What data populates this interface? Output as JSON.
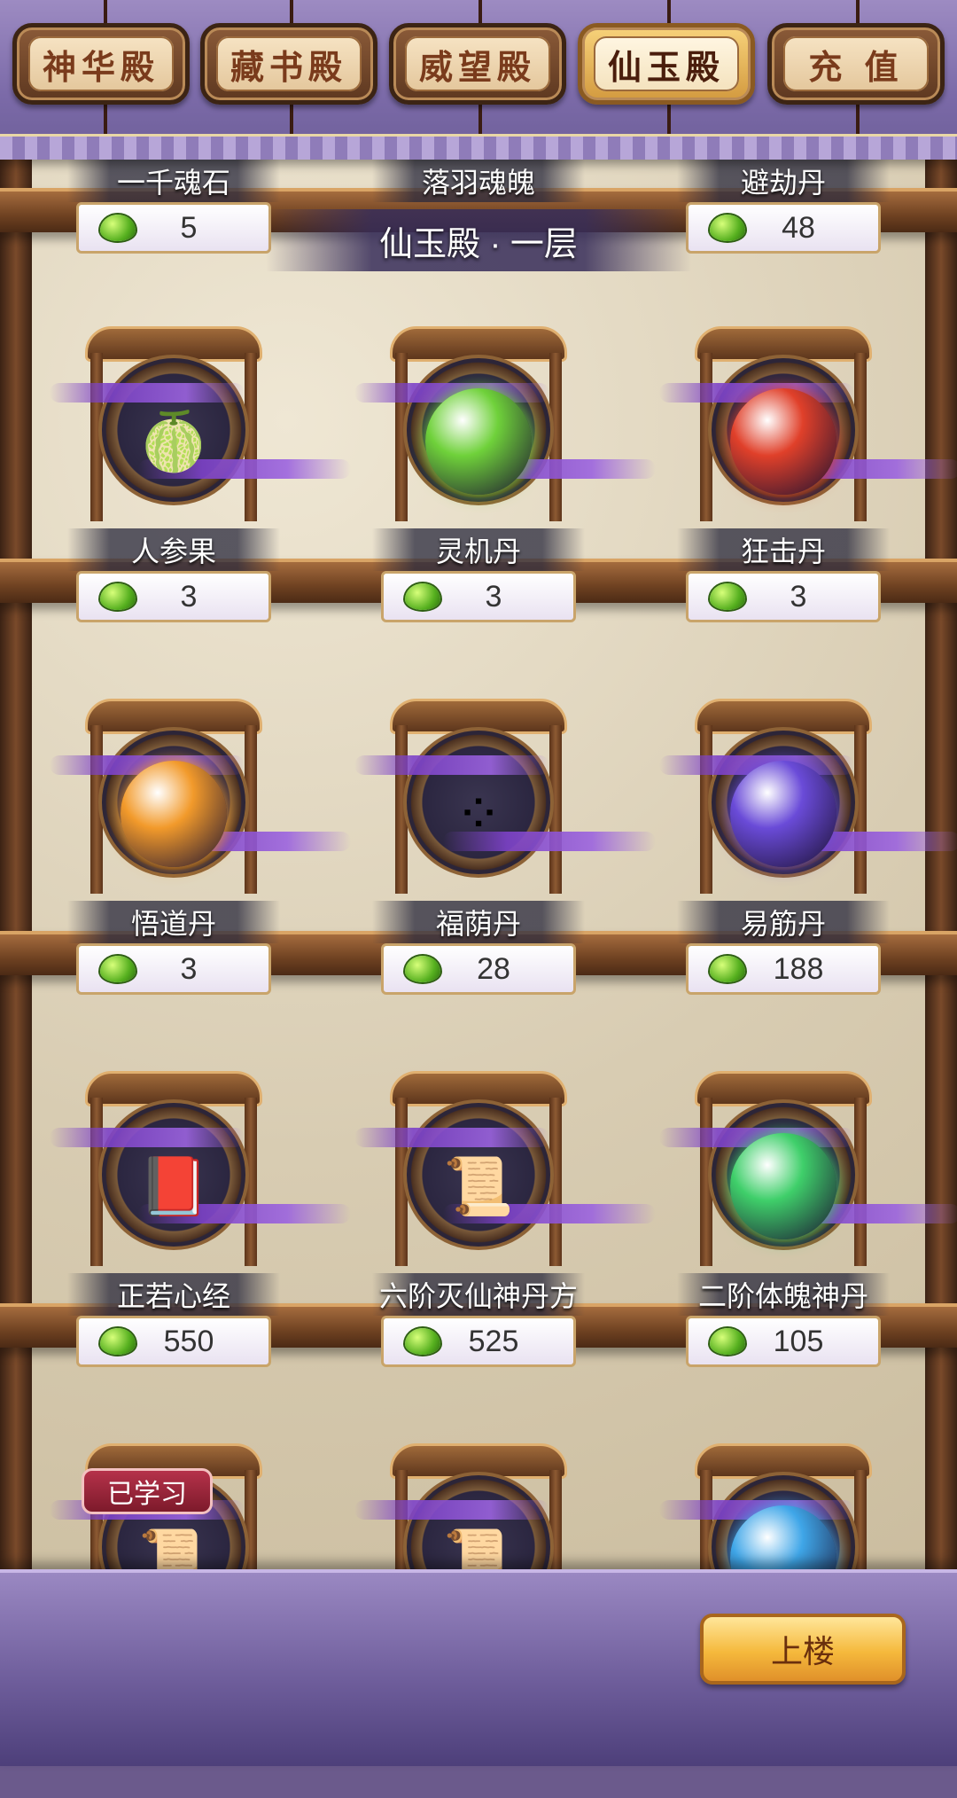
{
  "tabs": [
    {
      "label": "神华殿",
      "active": false
    },
    {
      "label": "藏书殿",
      "active": false
    },
    {
      "label": "威望殿",
      "active": false
    },
    {
      "label": "仙玉殿",
      "active": true
    },
    {
      "label": "充 值",
      "active": false
    }
  ],
  "floor_label": "仙玉殿 · 一层",
  "currency_icon": "jade-coin-icon",
  "top_row": [
    {
      "name": "一千魂石",
      "price": "5"
    },
    {
      "name": "落羽魂魄",
      "price": ""
    },
    {
      "name": "避劫丹",
      "price": "48"
    }
  ],
  "items": [
    {
      "name": "人参果",
      "price": "3",
      "icon": "ginseng-fruit-icon",
      "glyph": "🍈"
    },
    {
      "name": "灵机丹",
      "price": "3",
      "icon": "green-pill-icon",
      "glyph": "●"
    },
    {
      "name": "狂击丹",
      "price": "3",
      "icon": "red-pill-icon",
      "glyph": "●"
    },
    {
      "name": "悟道丹",
      "price": "3",
      "icon": "orange-pill-icon",
      "glyph": "●"
    },
    {
      "name": "福荫丹",
      "price": "28",
      "icon": "colored-pills-leaf-icon",
      "glyph": "⁘"
    },
    {
      "name": "易筋丹",
      "price": "188",
      "icon": "purple-orb-icon",
      "glyph": "●"
    },
    {
      "name": "正若心经",
      "price": "550",
      "icon": "book-icon",
      "glyph": "📕"
    },
    {
      "name": "六阶灭仙神丹方",
      "price": "525",
      "icon": "scroll-icon",
      "glyph": "📜"
    },
    {
      "name": "二阶体魄神丹",
      "price": "105",
      "icon": "green-orb-stand-icon",
      "glyph": "●"
    }
  ],
  "partial_row": [
    {
      "icon": "scroll-icon",
      "glyph": "📜"
    },
    {
      "icon": "scroll-icon",
      "glyph": "📜"
    },
    {
      "icon": "blue-orb-icon",
      "glyph": "●"
    }
  ],
  "learned_badge": "已学习",
  "upstairs_button": "上楼",
  "colors": {
    "red_pill": "#e0402a",
    "green_pill": "#6fd13a",
    "orange_pill": "#f29a2b",
    "purple_orb": "#6a4bd8",
    "green_orb": "#3fcf6a",
    "blue_orb": "#3fa6e8"
  }
}
